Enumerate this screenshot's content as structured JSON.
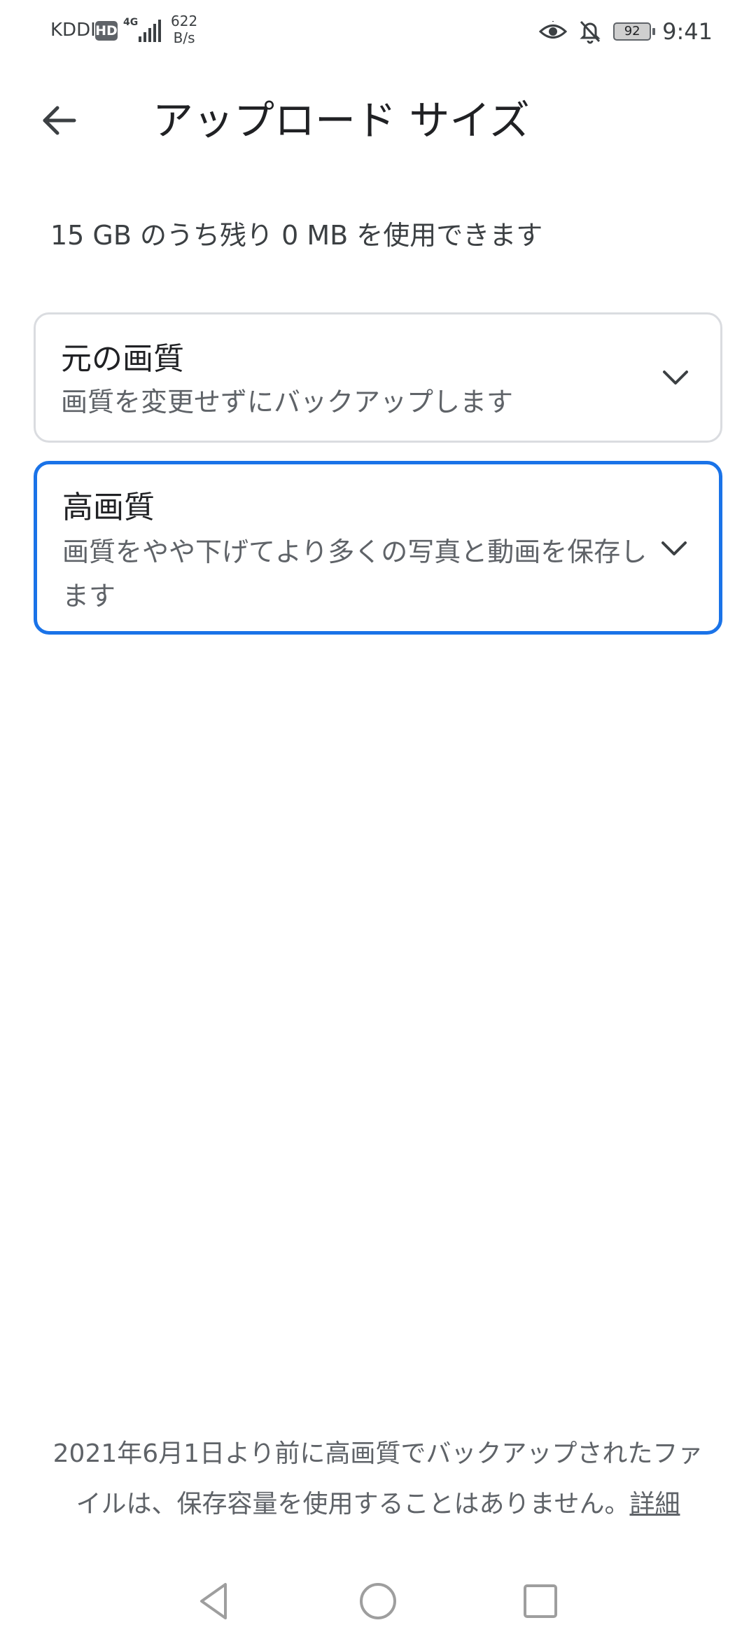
{
  "status_bar": {
    "carrier": "KDDI",
    "hd_badge": "HD",
    "network": "4G",
    "speed_value": "622",
    "speed_unit": "B/s",
    "battery": "92",
    "time": "9:41"
  },
  "header": {
    "title": "アップロード サイズ"
  },
  "storage": {
    "info": "15 GB のうち残り 0 MB を使用できます"
  },
  "options": [
    {
      "title": "元の画質",
      "description": "画質を変更せずにバックアップします",
      "selected": false
    },
    {
      "title": "高画質",
      "description": "画質をやや下げてより多くの写真と動画を保存します",
      "selected": true
    }
  ],
  "footer": {
    "note": "2021年6月1日より前に高画質でバックアップされたファイルは、保存容量を使用することはありません。",
    "details_link": "詳細"
  },
  "colors": {
    "accent": "#1a73e8",
    "card_border": "#dadce0",
    "text_primary": "#202124",
    "text_secondary": "#5f6368"
  }
}
